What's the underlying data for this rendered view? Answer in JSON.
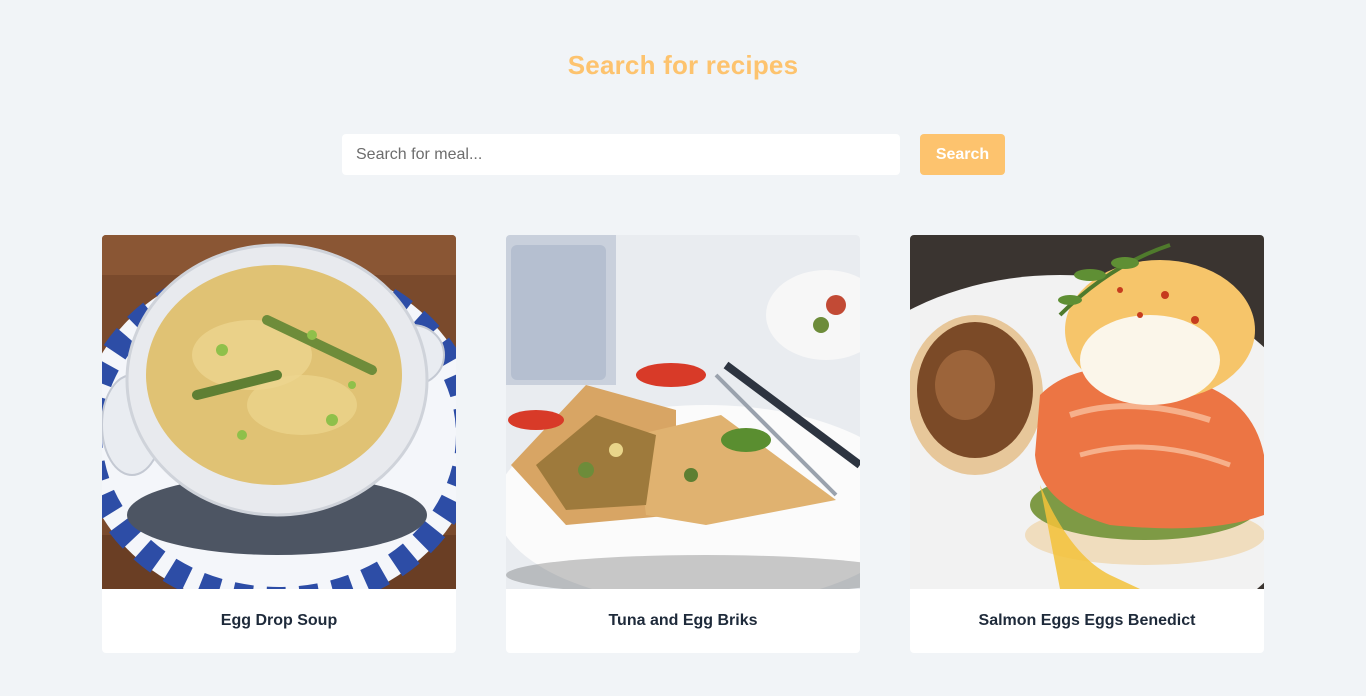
{
  "header": {
    "title": "Search for recipes"
  },
  "search": {
    "placeholder": "Search for meal...",
    "value": "",
    "button_label": "Search"
  },
  "meals": [
    {
      "name": "Egg Drop Soup",
      "image": "egg-drop-soup-photo"
    },
    {
      "name": "Tuna and Egg Briks",
      "image": "tuna-egg-briks-photo"
    },
    {
      "name": "Salmon Eggs Eggs Benedict",
      "image": "salmon-eggs-benedict-photo"
    }
  ],
  "colors": {
    "accent": "#fdc36e",
    "background": "#f1f4f7",
    "text": "#1e2a3a"
  }
}
